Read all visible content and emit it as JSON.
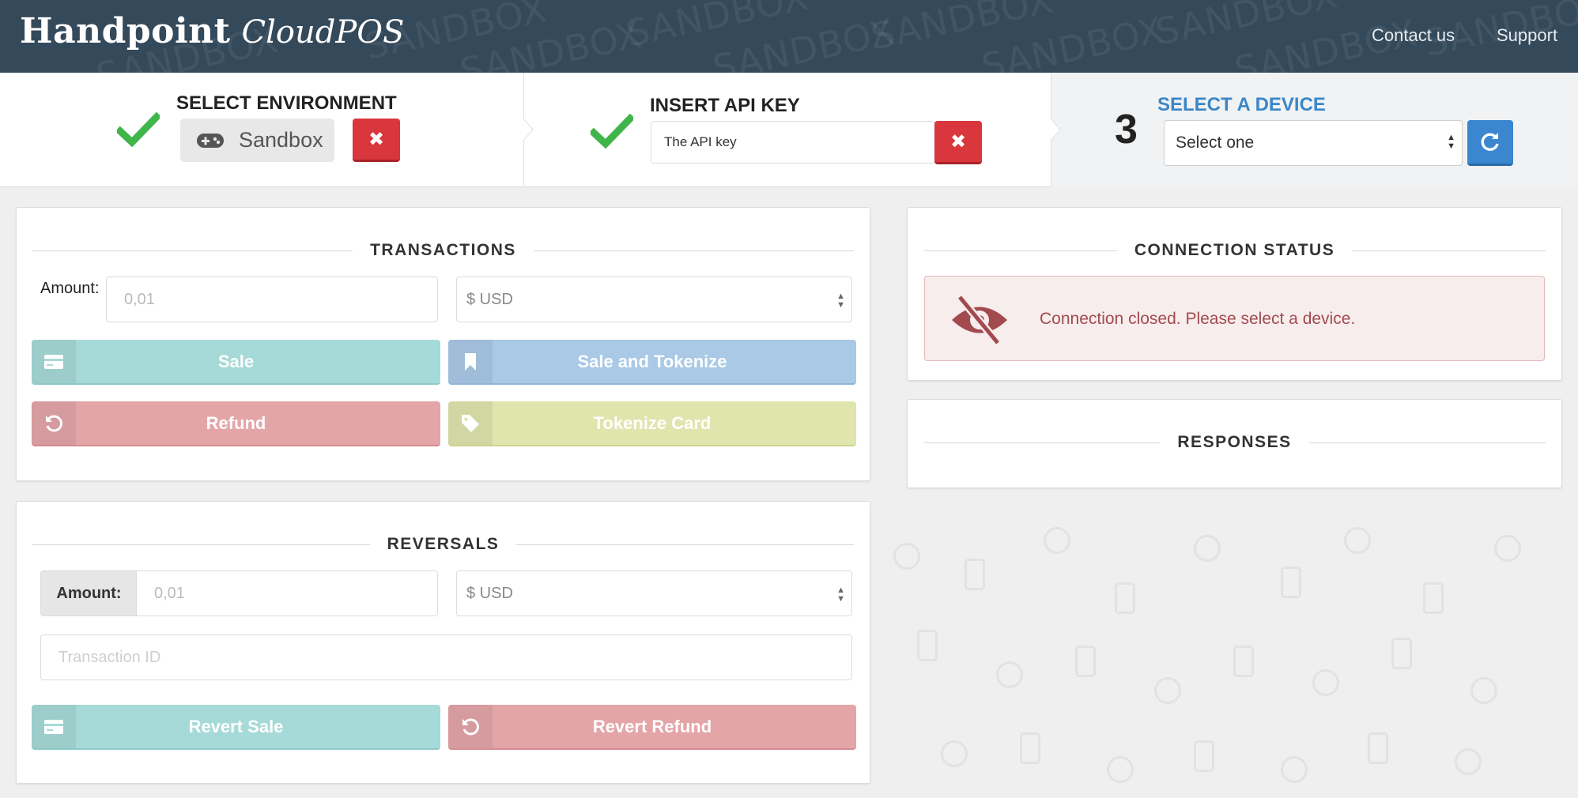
{
  "header": {
    "brand": "Handpoint",
    "product": "CloudPOS",
    "watermark": "SANDBOX",
    "nav": [
      "Contact us",
      "Support"
    ]
  },
  "steps": {
    "environment": {
      "title": "SELECT ENVIRONMENT",
      "value": "Sandbox",
      "status": "done"
    },
    "api_key": {
      "title": "INSERT API KEY",
      "value": "The API key",
      "status": "done"
    },
    "device": {
      "title": "SELECT A DEVICE",
      "number": "3",
      "select_value": "Select one",
      "status": "active"
    }
  },
  "transactions": {
    "title": "TRANSACTIONS",
    "amount_label": "Amount:",
    "amount_placeholder": "0,01",
    "currency": "$ USD",
    "buttons": {
      "sale": "Sale",
      "sale_tokenize": "Sale and Tokenize",
      "refund": "Refund",
      "tokenize_card": "Tokenize Card"
    }
  },
  "reversals": {
    "title": "REVERSALS",
    "amount_label": "Amount:",
    "amount_placeholder": "0,01",
    "currency": "$ USD",
    "transaction_id_placeholder": "Transaction ID",
    "buttons": {
      "revert_sale": "Revert Sale",
      "revert_refund": "Revert Refund"
    }
  },
  "connection": {
    "title": "CONNECTION STATUS",
    "message": "Connection closed. Please select a device."
  },
  "responses": {
    "title": "RESPONSES"
  },
  "colors": {
    "header_bg": "#34495a",
    "accent_blue": "#3a87d0",
    "danger": "#d9363e",
    "check_green": "#3fb54a",
    "sale": "#a6dad8",
    "sale_tokenize": "#a9c9e6",
    "refund": "#e4a5a8",
    "tokenize": "#dfe5ad"
  }
}
